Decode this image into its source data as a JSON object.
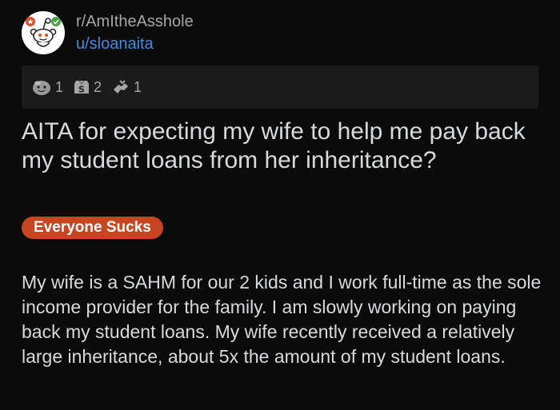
{
  "post": {
    "subreddit": "r/AmItheAsshole",
    "username": "u/sloanaita",
    "avatar_icon": "snoo-avatar-icon",
    "awards": [
      {
        "icon": "wholesome-award-icon",
        "count": "1"
      },
      {
        "icon": "silver-award-icon",
        "count": "2"
      },
      {
        "icon": "helpful-hand-award-icon",
        "count": "1"
      }
    ],
    "title": "AITA for expecting my wife to help me pay back my student loans from her inheritance?",
    "flair": "Everyone Sucks",
    "body": "My wife is a SAHM for our 2 kids and I work full-time as the sole income provider for the family. I am slowly working on paying back my student loans. My wife recently received a relatively large inheritance, about 5x the amount of my student loans."
  },
  "colors": {
    "background": "#0b0b0b",
    "awards_bar": "#1b1b1b",
    "username": "#3c8ce0",
    "subreddit": "#a4a6a8",
    "flair_bg": "#c7461f",
    "text": "#d7dadc"
  }
}
